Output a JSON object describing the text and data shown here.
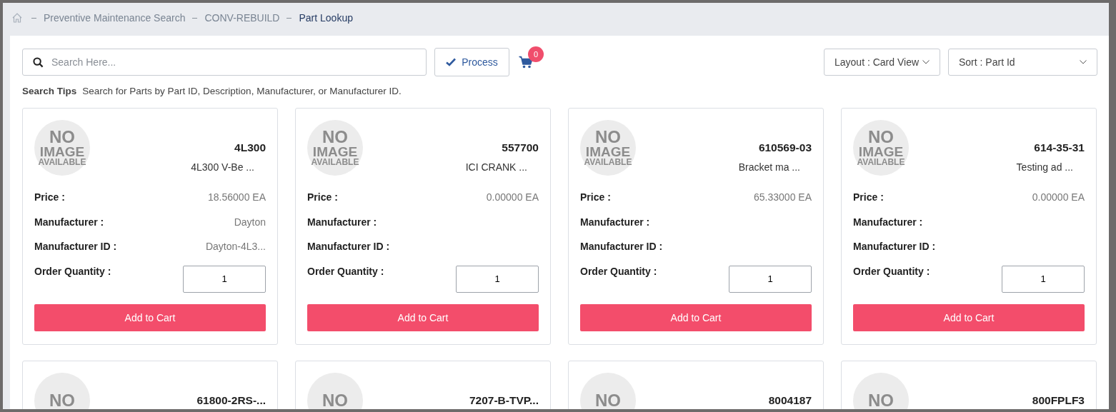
{
  "breadcrumb": [
    {
      "label": "Preventive Maintenance Search",
      "current": false
    },
    {
      "label": "CONV-REBUILD",
      "current": false
    },
    {
      "label": "Part Lookup",
      "current": true
    }
  ],
  "search": {
    "placeholder": "Search Here..."
  },
  "process_button": "Process",
  "cart_count": "0",
  "layout_select": "Layout : Card View",
  "sort_select": "Sort : Part Id",
  "search_tips": {
    "label": "Search Tips",
    "text": "Search for Parts by Part ID, Description, Manufacturer, or Manufacturer ID."
  },
  "cards": [
    {
      "image_text": [
        "NO",
        "IMAGE",
        "AVAILABLE"
      ],
      "part_id": "4L300",
      "description": "4L300 V-Be ...",
      "fields": [
        {
          "label": "Price :",
          "value": "18.56000 EA"
        },
        {
          "label": "Manufacturer :",
          "value": "Dayton"
        },
        {
          "label": "Manufacturer ID :",
          "value": "Dayton-4L3..."
        }
      ],
      "quantity_label": "Order Quantity :",
      "quantity": "1",
      "button": "Add to Cart"
    },
    {
      "image_text": [
        "NO",
        "IMAGE",
        "AVAILABLE"
      ],
      "part_id": "557700",
      "description": "ICI CRANK ...",
      "fields": [
        {
          "label": "Price :",
          "value": "0.00000 EA"
        },
        {
          "label": "Manufacturer :"
        },
        {
          "label": "Manufacturer ID :"
        }
      ],
      "quantity_label": "Order Quantity :",
      "quantity": "1",
      "button": "Add to Cart"
    },
    {
      "image_text": [
        "NO",
        "IMAGE",
        "AVAILABLE"
      ],
      "part_id": "610569-03",
      "description": "Bracket ma ...",
      "fields": [
        {
          "label": "Price :",
          "value": "65.33000 EA"
        },
        {
          "label": "Manufacturer :"
        },
        {
          "label": "Manufacturer ID :"
        }
      ],
      "quantity_label": "Order Quantity :",
      "quantity": "1",
      "button": "Add to Cart"
    },
    {
      "image_text": [
        "NO",
        "IMAGE",
        "AVAILABLE"
      ],
      "part_id": "614-35-31",
      "description": "Testing ad ...",
      "fields": [
        {
          "label": "Price :",
          "value": "0.00000 EA"
        },
        {
          "label": "Manufacturer :"
        },
        {
          "label": "Manufacturer ID :"
        }
      ],
      "quantity_label": "Order Quantity :",
      "quantity": "1",
      "button": "Add to Cart"
    },
    {
      "image_text": [
        "NO"
      ],
      "part_id": "61800-2RS-..."
    },
    {
      "image_text": [
        "NO"
      ],
      "part_id": "7207-B-TVP..."
    },
    {
      "image_text": [
        "NO"
      ],
      "part_id": "8004187"
    },
    {
      "image_text": [
        "NO"
      ],
      "part_id": "800FPLF3"
    }
  ]
}
